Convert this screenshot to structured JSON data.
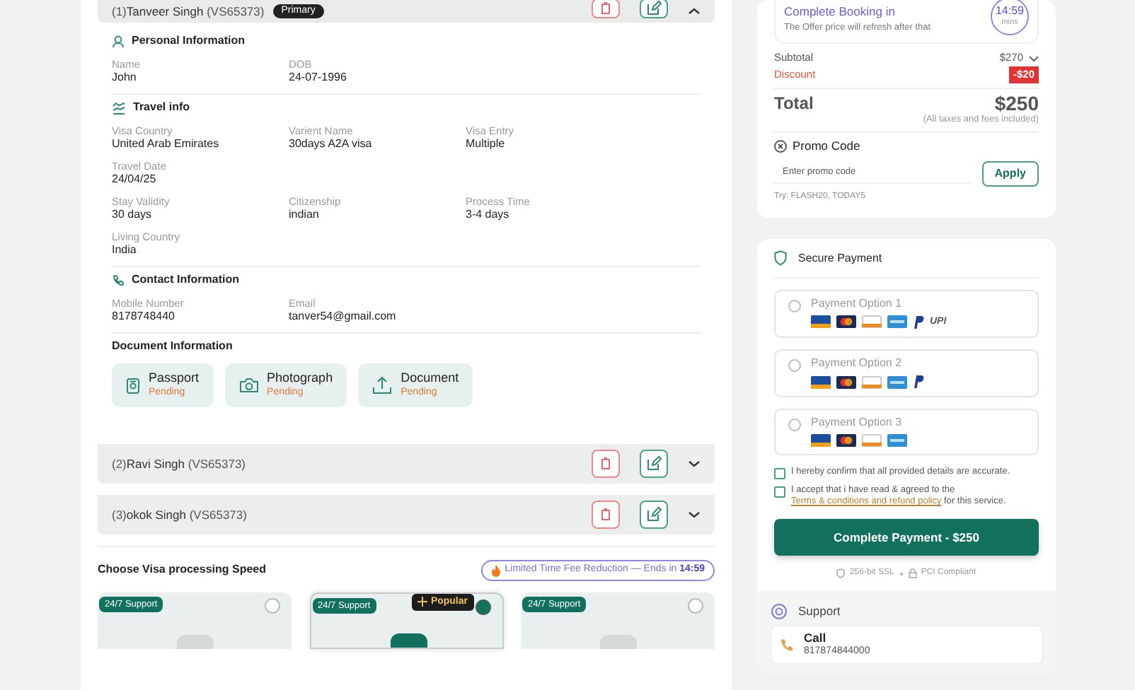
{
  "travelers": [
    {
      "number": "(1)",
      "name": "Tanveer Singh",
      "code": "(VS65373)",
      "badge": "Primary",
      "expanded": true,
      "sections": [
        {
          "kind": "personal",
          "title": "Personal Information",
          "rows": [
            [
              {
                "label": "Name",
                "value": "John"
              },
              {
                "label": "DOB",
                "value": "24-07-1996"
              }
            ]
          ]
        },
        {
          "kind": "travel",
          "title": "Travel info",
          "rows": [
            [
              {
                "label": "Visa Country",
                "value": "United Arab Emirates"
              },
              {
                "label": "Varient Name",
                "value": "30days A2A visa"
              },
              {
                "label": "Visa Entry",
                "value": "Multiple"
              }
            ],
            [
              {
                "label": "Travel Date",
                "value": "24/04/25"
              }
            ],
            [
              {
                "label": "Stay Validity",
                "value": "30 days"
              },
              {
                "label": "Citizenship",
                "value": "indian"
              },
              {
                "label": "Process Time",
                "value": "3-4 days"
              }
            ],
            [
              {
                "label": "Living Country",
                "value": "India"
              }
            ]
          ]
        },
        {
          "kind": "contact",
          "title": "Contact Information",
          "rows": [
            [
              {
                "label": "Mobile Number",
                "value": "8178748440"
              },
              {
                "label": "Email",
                "value": "tanver54@gmail.com"
              }
            ]
          ]
        }
      ],
      "documents": {
        "title": "Document Information",
        "items": [
          {
            "kind": "passport",
            "label": "Passport",
            "status": "Pending"
          },
          {
            "kind": "photo",
            "label": "Photograph",
            "status": "Pending"
          },
          {
            "kind": "upload",
            "label": "Document",
            "status": "Pending"
          }
        ]
      }
    },
    {
      "number": "(2)",
      "name": "Ravi Singh",
      "code": "(VS65373)",
      "expanded": false
    },
    {
      "number": "(3)",
      "name": "okok Singh",
      "code": "(VS65373)",
      "expanded": false
    }
  ],
  "processing_speed": {
    "title": "Choose Visa processing Speed",
    "offer": {
      "text": "Limited Time Fee Reduction — Ends in",
      "time": "14:59"
    },
    "options": [
      {
        "badge": "24/7 Support",
        "selected": false
      },
      {
        "badge": "24/7 Support",
        "tag": "Popular",
        "selected": true
      },
      {
        "badge": "24/7 Support",
        "selected": false
      }
    ]
  },
  "booking_timer": {
    "title": "Complete Booking in",
    "note": "The Offer price will refresh after that",
    "time": "14:59",
    "unit": "mins"
  },
  "summary": {
    "subtotal": {
      "label": "Subtotal",
      "value": "$270"
    },
    "discount": {
      "label": "Discount",
      "value": "-$20"
    },
    "total": {
      "label": "Total",
      "value": "$250",
      "note": "(All taxes and fees included)"
    }
  },
  "promo": {
    "title": "Promo Code",
    "placeholder": "Enter promo code",
    "button": "Apply",
    "hint": "Try: FLASH20, TODAY5"
  },
  "payment": {
    "title": "Secure Payment",
    "options": [
      {
        "label": "Payment Option 1",
        "selected": false,
        "methods": [
          {
            "kind": "visa"
          },
          {
            "kind": "mastercard"
          },
          {
            "kind": "discover"
          },
          {
            "kind": "amex"
          },
          {
            "kind": "paypal"
          },
          {
            "kind": "upi",
            "text": "UPI"
          }
        ]
      },
      {
        "label": "Payment Option 2",
        "selected": false,
        "methods": [
          {
            "kind": "visa"
          },
          {
            "kind": "mastercard"
          },
          {
            "kind": "discover"
          },
          {
            "kind": "amex"
          },
          {
            "kind": "paypal"
          }
        ]
      },
      {
        "label": "Payment Option 3",
        "selected": false,
        "methods": [
          {
            "kind": "visa"
          },
          {
            "kind": "mastercard"
          },
          {
            "kind": "discover"
          },
          {
            "kind": "amex"
          }
        ]
      }
    ]
  },
  "consents": [
    {
      "text": "I hereby confirm that all provided details are accurate.",
      "checked": false
    },
    {
      "text": "I accept that i have read & agreed to the ",
      "link": "Terms & conditions and refund policy",
      "after": " for this service.",
      "checked": false
    }
  ],
  "pay_button": "Complete Payment - $250",
  "security": [
    {
      "kind": "shield",
      "text": "256-bit SSL"
    },
    {
      "kind": "lock",
      "text": "PCI Compliant"
    }
  ],
  "support": {
    "title": "Support",
    "call": {
      "title": "Call",
      "number": "817874844000"
    }
  }
}
